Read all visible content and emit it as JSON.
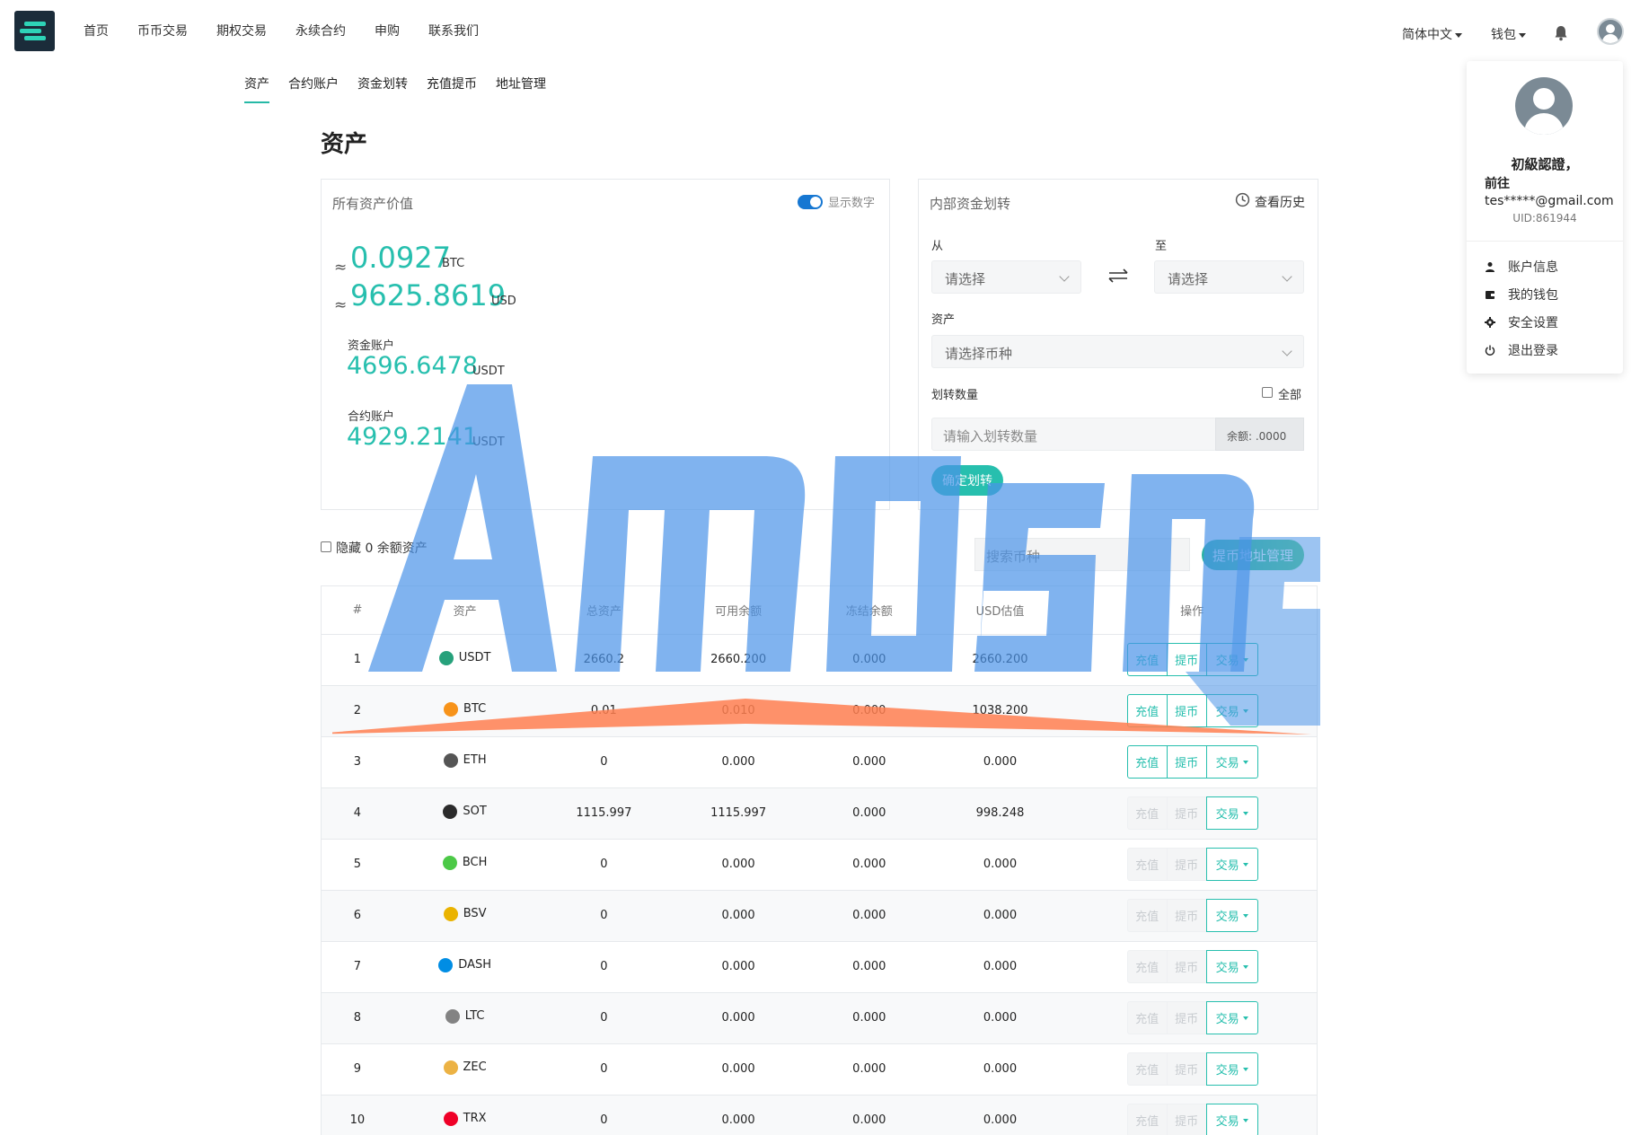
{
  "nav": {
    "items": [
      "首页",
      "币币交易",
      "期权交易",
      "永续合约",
      "申购",
      "联系我们"
    ],
    "language": "简体中文",
    "wallet": "钱包"
  },
  "subnav": {
    "items": [
      "资产",
      "合约账户",
      "资金划转",
      "充值提币",
      "地址管理"
    ],
    "active": 0
  },
  "page_title": "资产",
  "assets_card": {
    "title": "所有资产价值",
    "toggle_label": "显示数字",
    "approx": "≈",
    "btc_value": "0.0927",
    "btc_unit": "BTC",
    "usd_value": "9625.8619",
    "usd_unit": "USD",
    "fund_label": "资金账户",
    "fund_value": "4696.6478",
    "fund_unit": "USDT",
    "contract_label": "合约账户",
    "contract_value": "4929.2141",
    "contract_unit": "USDT"
  },
  "transfer_card": {
    "title": "内部资金划转",
    "history": "查看历史",
    "from_label": "从",
    "to_label": "至",
    "from_placeholder": "请选择",
    "to_placeholder": "请选择",
    "asset_label": "资产",
    "asset_placeholder": "请选择币种",
    "amount_label": "划转数量",
    "all_label": "全部",
    "amount_placeholder": "请输入划转数量",
    "balance_addon": "余额: .0000",
    "confirm": "确定划转"
  },
  "filters": {
    "hide_zero": "隐藏 0 余额资产",
    "search_placeholder": "搜索币种",
    "address_btn": "提币地址管理"
  },
  "table": {
    "headers": [
      "#",
      "资产",
      "总资产",
      "可用余额",
      "冻结余额",
      "USD估值",
      "操作"
    ],
    "deposit": "充值",
    "withdraw": "提币",
    "trade": "交易",
    "rows": [
      {
        "no": "1",
        "coin": "USDT",
        "total": "2660.2",
        "avail": "2660.200",
        "frozen": "0.000",
        "usd": "2660.200",
        "enabled": true,
        "color": "#26a17b"
      },
      {
        "no": "2",
        "coin": "BTC",
        "total": "0.01",
        "avail": "0.010",
        "frozen": "0.000",
        "usd": "1038.200",
        "enabled": true,
        "color": "#f7931a"
      },
      {
        "no": "3",
        "coin": "ETH",
        "total": "0",
        "avail": "0.000",
        "frozen": "0.000",
        "usd": "0.000",
        "enabled": true,
        "color": "#555555"
      },
      {
        "no": "4",
        "coin": "SOT",
        "total": "1115.997",
        "avail": "1115.997",
        "frozen": "0.000",
        "usd": "998.248",
        "enabled": false,
        "color": "#2b2b2b"
      },
      {
        "no": "5",
        "coin": "BCH",
        "total": "0",
        "avail": "0.000",
        "frozen": "0.000",
        "usd": "0.000",
        "enabled": false,
        "color": "#4cc947"
      },
      {
        "no": "6",
        "coin": "BSV",
        "total": "0",
        "avail": "0.000",
        "frozen": "0.000",
        "usd": "0.000",
        "enabled": false,
        "color": "#eab300"
      },
      {
        "no": "7",
        "coin": "DASH",
        "total": "0",
        "avail": "0.000",
        "frozen": "0.000",
        "usd": "0.000",
        "enabled": false,
        "color": "#008de4"
      },
      {
        "no": "8",
        "coin": "LTC",
        "total": "0",
        "avail": "0.000",
        "frozen": "0.000",
        "usd": "0.000",
        "enabled": false,
        "color": "#838383"
      },
      {
        "no": "9",
        "coin": "ZEC",
        "total": "0",
        "avail": "0.000",
        "frozen": "0.000",
        "usd": "0.000",
        "enabled": false,
        "color": "#ecb244"
      },
      {
        "no": "10",
        "coin": "TRX",
        "total": "0",
        "avail": "0.000",
        "frozen": "0.000",
        "usd": "0.000",
        "enabled": false,
        "color": "#ef0027"
      }
    ]
  },
  "profile": {
    "level": "初級認證，",
    "go": "前往",
    "email": "tes*****@gmail.com",
    "uid": "UID:861944",
    "menu": [
      "账户信息",
      "我的钱包",
      "安全设置",
      "退出登录"
    ]
  },
  "colors": {
    "accent": "#27bfae",
    "toggle": "#1677d2"
  }
}
